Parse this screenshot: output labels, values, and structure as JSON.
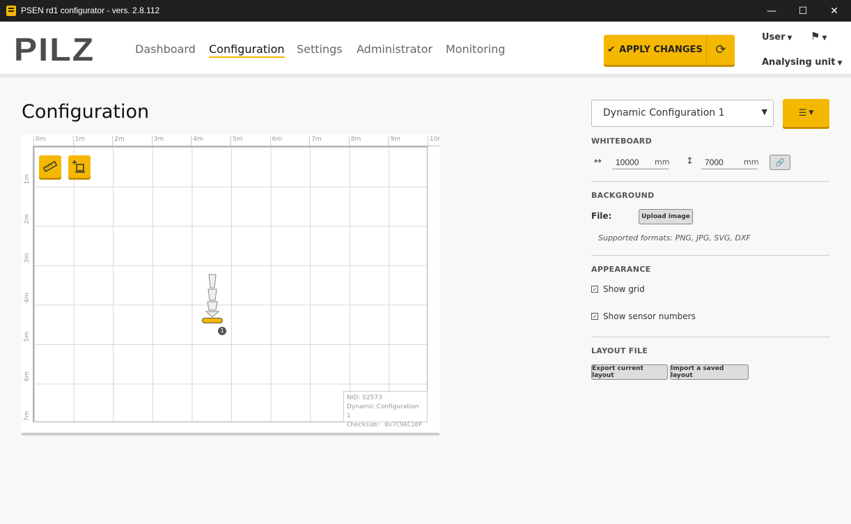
{
  "window": {
    "title": "PSEN rd1 configurator - vers. 2.8.112",
    "minimize": "—",
    "maximize": "☐",
    "close": "✕"
  },
  "header": {
    "logo": "PILZ",
    "nav": [
      "Dashboard",
      "Configuration",
      "Settings",
      "Administrator",
      "Monitoring"
    ],
    "active_nav": "Configuration",
    "apply_label": "APPLY CHANGES",
    "user_label": "User",
    "unit_label": "Analysing unit"
  },
  "main": {
    "title": "Configuration",
    "ruler_x": [
      "0m",
      "1m",
      "2m",
      "3m",
      "4m",
      "5m",
      "6m",
      "7m",
      "8m",
      "9m",
      "10r"
    ],
    "ruler_y": [
      "1m",
      "2m",
      "3m",
      "4m",
      "5m",
      "6m",
      "7m"
    ],
    "sensor_number": "1",
    "info": {
      "nid": "NID: 02573",
      "config": "Dynamic Configuration 1",
      "checksum": "Checksum: 0x7C9AC10F"
    }
  },
  "panel": {
    "config_select": "Dynamic Configuration 1",
    "whiteboard_title": "WHITEBOARD",
    "width_value": "10000",
    "height_value": "7000",
    "unit": "mm",
    "background_title": "BACKGROUND",
    "file_label": "File:",
    "upload_label": "Upload image",
    "formats_hint": "Supported formats: PNG, JPG, SVG, DXF",
    "appearance_title": "APPEARANCE",
    "show_grid_label": "Show grid",
    "show_grid_checked": true,
    "show_numbers_label": "Show sensor numbers",
    "show_numbers_checked": true,
    "layout_title": "LAYOUT FILE",
    "export_label": "Export current layout",
    "import_label": "Import a saved layout"
  },
  "colors": {
    "accent": "#f5b800",
    "titlebar": "#202020"
  }
}
